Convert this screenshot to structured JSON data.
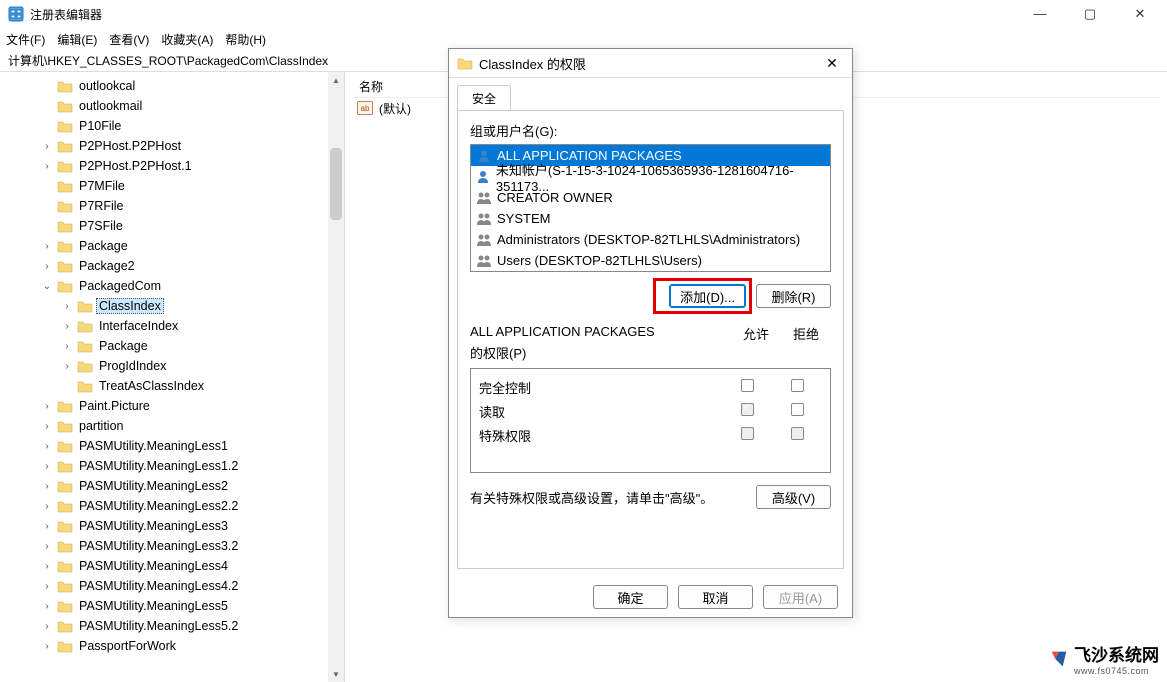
{
  "window": {
    "title": "注册表编辑器"
  },
  "menu": {
    "file": "文件(F)",
    "edit": "编辑(E)",
    "view": "查看(V)",
    "fav": "收藏夹(A)",
    "help": "帮助(H)"
  },
  "address": "计算机\\HKEY_CLASSES_ROOT\\PackagedCom\\ClassIndex",
  "tree": [
    {
      "ind": 2,
      "exp": "",
      "name": "outlookcal"
    },
    {
      "ind": 2,
      "exp": "",
      "name": "outlookmail"
    },
    {
      "ind": 2,
      "exp": "",
      "name": "P10File"
    },
    {
      "ind": 2,
      "exp": ">",
      "name": "P2PHost.P2PHost"
    },
    {
      "ind": 2,
      "exp": ">",
      "name": "P2PHost.P2PHost.1"
    },
    {
      "ind": 2,
      "exp": "",
      "name": "P7MFile"
    },
    {
      "ind": 2,
      "exp": "",
      "name": "P7RFile"
    },
    {
      "ind": 2,
      "exp": "",
      "name": "P7SFile"
    },
    {
      "ind": 2,
      "exp": ">",
      "name": "Package"
    },
    {
      "ind": 2,
      "exp": ">",
      "name": "Package2"
    },
    {
      "ind": 2,
      "exp": "v",
      "name": "PackagedCom",
      "open": true
    },
    {
      "ind": 3,
      "exp": ">",
      "name": "ClassIndex",
      "sel": true
    },
    {
      "ind": 3,
      "exp": ">",
      "name": "InterfaceIndex"
    },
    {
      "ind": 3,
      "exp": ">",
      "name": "Package"
    },
    {
      "ind": 3,
      "exp": ">",
      "name": "ProgIdIndex"
    },
    {
      "ind": 3,
      "exp": "",
      "name": "TreatAsClassIndex"
    },
    {
      "ind": 2,
      "exp": ">",
      "name": "Paint.Picture"
    },
    {
      "ind": 2,
      "exp": ">",
      "name": "partition"
    },
    {
      "ind": 2,
      "exp": ">",
      "name": "PASMUtility.MeaningLess1"
    },
    {
      "ind": 2,
      "exp": ">",
      "name": "PASMUtility.MeaningLess1.2"
    },
    {
      "ind": 2,
      "exp": ">",
      "name": "PASMUtility.MeaningLess2"
    },
    {
      "ind": 2,
      "exp": ">",
      "name": "PASMUtility.MeaningLess2.2"
    },
    {
      "ind": 2,
      "exp": ">",
      "name": "PASMUtility.MeaningLess3"
    },
    {
      "ind": 2,
      "exp": ">",
      "name": "PASMUtility.MeaningLess3.2"
    },
    {
      "ind": 2,
      "exp": ">",
      "name": "PASMUtility.MeaningLess4"
    },
    {
      "ind": 2,
      "exp": ">",
      "name": "PASMUtility.MeaningLess4.2"
    },
    {
      "ind": 2,
      "exp": ">",
      "name": "PASMUtility.MeaningLess5"
    },
    {
      "ind": 2,
      "exp": ">",
      "name": "PASMUtility.MeaningLess5.2"
    },
    {
      "ind": 2,
      "exp": ">",
      "name": "PassportForWork"
    }
  ],
  "right": {
    "col_name": "名称",
    "default_value": "(默认)"
  },
  "dialog": {
    "title": "ClassIndex 的权限",
    "tab": "安全",
    "group_label": "组或用户名(G):",
    "users": [
      {
        "name": "ALL APPLICATION PACKAGES",
        "sel": true,
        "type": "single"
      },
      {
        "name": "未知帐户(S-1-15-3-1024-1065365936-1281604716-351173...",
        "type": "single"
      },
      {
        "name": "CREATOR OWNER",
        "type": "group"
      },
      {
        "name": "SYSTEM",
        "type": "group"
      },
      {
        "name": "Administrators (DESKTOP-82TLHLS\\Administrators)",
        "type": "group"
      },
      {
        "name": "Users (DESKTOP-82TLHLS\\Users)",
        "type": "group"
      }
    ],
    "btn_add": "添加(D)...",
    "btn_remove": "删除(R)",
    "perm_for_1": "ALL APPLICATION PACKAGES",
    "perm_for_2": "的权限(P)",
    "perm_allow": "允许",
    "perm_deny": "拒绝",
    "perms": [
      {
        "name": "完全控制",
        "allow": false,
        "deny": false
      },
      {
        "name": "读取",
        "allow": true,
        "deny": false,
        "allow_dimmed": true
      },
      {
        "name": "特殊权限",
        "allow": false,
        "deny": false,
        "dimmed": true
      }
    ],
    "adv_text": "有关特殊权限或高级设置，请单击\"高级\"。",
    "btn_adv": "高级(V)",
    "btn_ok": "确定",
    "btn_cancel": "取消",
    "btn_apply": "应用(A)"
  },
  "watermark": {
    "text": "飞沙系统网",
    "url": "www.fs0745.com"
  }
}
